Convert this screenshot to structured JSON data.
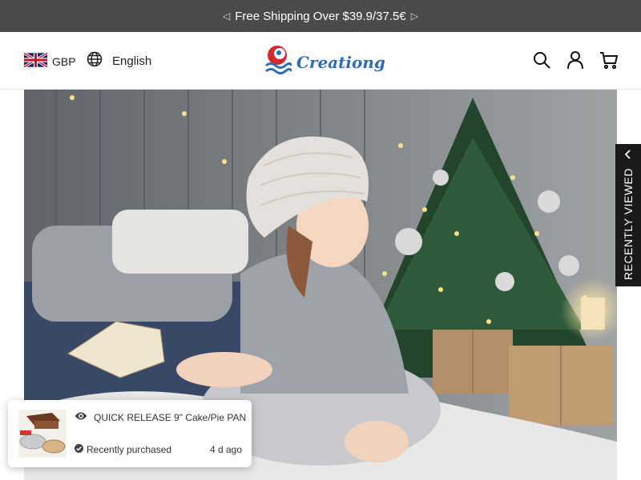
{
  "announcement": {
    "text": "Free Shipping Over $39.9/37.5€"
  },
  "header": {
    "currency": "GBP",
    "language": "English",
    "logo_text": "Creationg"
  },
  "icons": {
    "flag": "uk-flag-icon",
    "language": "globe-icon",
    "search": "search-icon",
    "account": "user-icon",
    "cart": "cart-icon",
    "eye": "eye-icon",
    "check": "check-circle-icon",
    "chevron": "chevron-left-icon"
  },
  "recently_viewed": {
    "label": "RECENTLY VIEWED"
  },
  "purchase_popup": {
    "product": "QUICK RELEASE 9\" Cake/Pie PAN",
    "status": "Recently purchased",
    "time_ago": "4 d ago"
  },
  "colors": {
    "announcement_bg": "#4a4a4a",
    "logo_blue": "#2e6db5",
    "logo_red": "#d7262e",
    "tab_bg": "#1a1a1a"
  }
}
